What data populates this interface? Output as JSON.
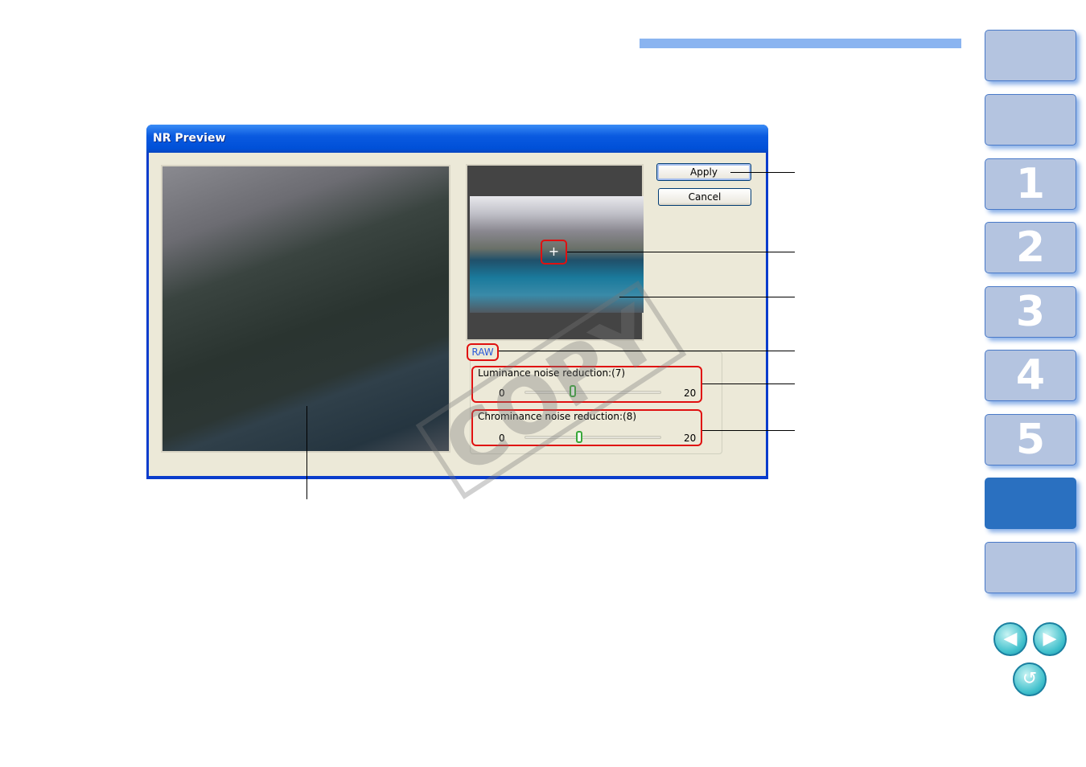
{
  "dialog": {
    "title": "NR Preview",
    "apply_label": "Apply",
    "cancel_label": "Cancel",
    "raw_label": "RAW",
    "crosshair_icon": "+",
    "luminance": {
      "label": "Luminance noise reduction:(7)",
      "min": "0",
      "max": "20",
      "value": 7
    },
    "chrominance": {
      "label": "Chrominance noise reduction:(8)",
      "min": "0",
      "max": "20",
      "value": 8
    }
  },
  "watermark": "COPY",
  "sidebar": {
    "tabs": [
      {
        "label": ""
      },
      {
        "label": ""
      },
      {
        "label": "1"
      },
      {
        "label": "2"
      },
      {
        "label": "3"
      },
      {
        "label": "4"
      },
      {
        "label": "5"
      },
      {
        "label": "",
        "active": true
      },
      {
        "label": ""
      }
    ],
    "prev_icon": "◀",
    "next_icon": "▶",
    "return_icon": "↺"
  },
  "colors": {
    "accent": "#8ab4f0",
    "tab": "#b4c4e0",
    "tab_active": "#2a70c0",
    "highlight": "#e01010"
  }
}
